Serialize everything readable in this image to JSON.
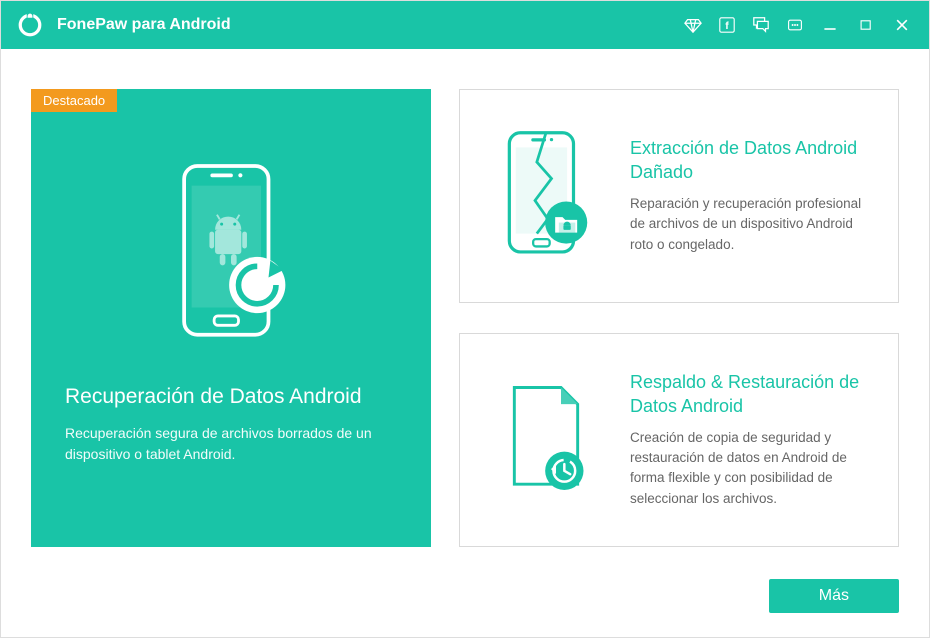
{
  "app": {
    "title": "FonePaw para Android"
  },
  "featured_badge": "Destacado",
  "main_tile": {
    "title": "Recuperación de Datos Android",
    "desc": "Recuperación segura de archivos borrados de un dispositivo o tablet Android."
  },
  "tiles": [
    {
      "title": "Extracción de Datos Android Dañado",
      "desc": "Reparación y recuperación profesional de archivos de un dispositivo Android roto o congelado."
    },
    {
      "title": "Respaldo & Restauración de Datos Android",
      "desc": "Creación de copia de seguridad y restauración de datos en Android de forma flexible y con posibilidad de seleccionar los archivos."
    }
  ],
  "more_button": "Más"
}
